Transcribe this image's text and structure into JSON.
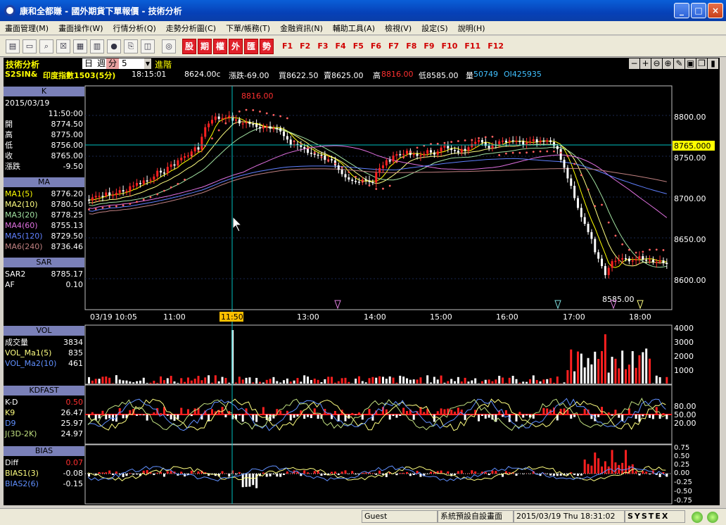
{
  "window": {
    "title": "康和全都賺 - 國外期貨下單報價 - 技術分析",
    "controls": [
      "_",
      "□",
      "×"
    ]
  },
  "menu": [
    "畫面管理(M)",
    "畫面操作(W)",
    "行情分析(Q)",
    "走勢分析圖(C)",
    "下單/帳務(T)",
    "金融資訊(N)",
    "輔助工具(A)",
    "檢視(V)",
    "設定(S)",
    "說明(H)"
  ],
  "toolbar": {
    "red_buttons": [
      "股",
      "期",
      "權",
      "外",
      "匯",
      "勢"
    ],
    "fkeys": [
      "F1",
      "F2",
      "F3",
      "F4",
      "F5",
      "F6",
      "F7",
      "F8",
      "F9",
      "F10",
      "F11",
      "F12"
    ]
  },
  "panel": {
    "title": "技術分析",
    "period_tabs": [
      "日",
      "週",
      "月",
      "分"
    ],
    "interval": "5",
    "advance": "進階"
  },
  "quote": {
    "symbol": "S2SIN&",
    "name": "印度指數1503(5分)",
    "time": "18:15:01",
    "last": "8624.00c",
    "change": "漲跌-69.00",
    "bid": "買8622.50",
    "ask": "賣8625.00",
    "high_label": "高",
    "high": "8816.00",
    "low": "低8585.00",
    "vol_label": "量",
    "vol": "50749",
    "oi": "OI425935"
  },
  "k_panel": {
    "title": "K",
    "date": "2015/03/19",
    "time": "11:50:00",
    "open_label": "開",
    "open": "8774.50",
    "high_label": "高",
    "high": "8775.00",
    "low_label": "低",
    "low": "8756.00",
    "close_label": "收",
    "close": "8765.00",
    "chg_label": "漲跌",
    "chg": "-9.50"
  },
  "ma_panel": {
    "title": "MA",
    "items": [
      {
        "label": "MA1(5)",
        "value": "8776.20",
        "color": "#ffff00"
      },
      {
        "label": "MA2(10)",
        "value": "8780.50",
        "color": "#ffff80"
      },
      {
        "label": "MA3(20)",
        "value": "8778.25",
        "color": "#a0e0a0"
      },
      {
        "label": "MA4(60)",
        "value": "8755.13",
        "color": "#e070e0"
      },
      {
        "label": "MA5(120)",
        "value": "8729.50",
        "color": "#6080ff"
      },
      {
        "label": "MA6(240)",
        "value": "8736.46",
        "color": "#c08080"
      }
    ]
  },
  "sar_panel": {
    "title": "SAR",
    "items": [
      {
        "label": "SAR2",
        "value": "8785.17"
      },
      {
        "label": "AF",
        "value": "0.10"
      }
    ]
  },
  "vol_panel": {
    "title": "VOL",
    "items": [
      {
        "label": "成交量",
        "value": "3834"
      },
      {
        "label": "VOL_Ma1(5)",
        "value": "835"
      },
      {
        "label": "VOL_Ma2(10)",
        "value": "461"
      }
    ]
  },
  "kd_panel": {
    "title": "KDFAST",
    "items": [
      {
        "label": "K-D",
        "value": "0.50"
      },
      {
        "label": "K9",
        "value": "26.47"
      },
      {
        "label": "D9",
        "value": "25.97"
      },
      {
        "label": "J(3D-2K)",
        "value": "24.97"
      }
    ]
  },
  "bias_panel": {
    "title": "BIAS",
    "items": [
      {
        "label": "Diff",
        "value": "0.07"
      },
      {
        "label": "BIAS1(3)",
        "value": "-0.08"
      },
      {
        "label": "BIAS2(6)",
        "value": "-0.15"
      }
    ]
  },
  "axis": {
    "price_ticks": [
      "8800.00",
      "8750.00",
      "8700.00",
      "8650.00",
      "8600.00"
    ],
    "current_price": "8765.000",
    "high_mark": "8816.00",
    "low_mark": "8585.00",
    "time_labels": [
      "03/19 10:05",
      "11:00",
      "11:50",
      "13:00",
      "14:00",
      "15:00",
      "16:00",
      "17:00",
      "18:00"
    ],
    "vol_ticks": [
      "4000",
      "3000",
      "2000",
      "1000"
    ],
    "kd_ticks": [
      "80.00",
      "50.00",
      "20.00"
    ],
    "bias_ticks": [
      "0.75",
      "0.50",
      "0.25",
      "0.00",
      "-0.25",
      "-0.50",
      "-0.75"
    ]
  },
  "status": {
    "user": "Guest",
    "layout": "系統預設自設畫面",
    "datetime": "2015/03/19 Thu 18:31:02",
    "brand": "SYSTEX"
  },
  "colors": {
    "bg": "#000000",
    "up": "#ff2020",
    "down": "#ffffff",
    "sar": "#ff6060",
    "grid": "#203060",
    "crosshair": "#00c0c0"
  }
}
